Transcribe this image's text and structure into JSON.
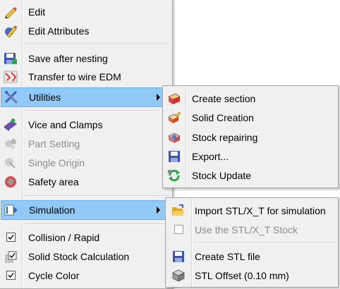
{
  "main_menu": {
    "items": [
      {
        "id": "edit",
        "label": "Edit",
        "icon": "pencil-icon",
        "enabled": true
      },
      {
        "id": "edit-attributes",
        "label": "Edit Attributes",
        "icon": "edit-attributes-icon",
        "enabled": true
      },
      {
        "id": "save-after-nesting",
        "label": "Save after nesting",
        "icon": "save-after-nesting-icon",
        "enabled": true
      },
      {
        "id": "transfer-to-wire-edm",
        "label": "Transfer to wire EDM",
        "icon": "wire-edm-icon",
        "enabled": true
      },
      {
        "id": "utilities",
        "label": "Utilities",
        "icon": "utilities-icon",
        "enabled": true,
        "submenu": true,
        "highlighted": true
      },
      {
        "id": "vice-and-clamps",
        "label": "Vice and Clamps",
        "icon": "vice-icon",
        "enabled": true
      },
      {
        "id": "part-setting",
        "label": "Part Setting",
        "icon": "part-setting-icon",
        "enabled": false
      },
      {
        "id": "single-origin",
        "label": "Single Origin",
        "icon": "origin-icon",
        "enabled": false
      },
      {
        "id": "safety-area",
        "label": "Safety area",
        "icon": "safety-area-icon",
        "enabled": true
      },
      {
        "id": "simulation",
        "label": "Simulation",
        "icon": "simulation-icon",
        "enabled": true,
        "submenu": true,
        "highlighted": true
      },
      {
        "id": "collision-rapid",
        "label": "Collision / Rapid",
        "checked": true,
        "enabled": true
      },
      {
        "id": "solid-stock-calculation",
        "label": "Solid Stock Calculation",
        "checked": true,
        "enabled": true
      },
      {
        "id": "cycle-color",
        "label": "Cycle Color",
        "checked": true,
        "enabled": true
      }
    ]
  },
  "utilities_submenu": {
    "items": [
      {
        "id": "create-section",
        "label": "Create section",
        "icon": "section-icon"
      },
      {
        "id": "solid-creation",
        "label": "Solid Creation",
        "icon": "solid-creation-icon"
      },
      {
        "id": "stock-repairing",
        "label": "Stock repairing",
        "icon": "stock-repair-icon"
      },
      {
        "id": "export",
        "label": "Export...",
        "icon": "floppy-icon"
      },
      {
        "id": "stock-update",
        "label": "Stock Update",
        "icon": "refresh-icon"
      }
    ]
  },
  "simulation_submenu": {
    "items": [
      {
        "id": "import-stl",
        "label": "Import STL/X_T for simulation",
        "icon": "folder-open-icon",
        "enabled": true
      },
      {
        "id": "use-stl-stock",
        "label": "Use the STL/X_T Stock",
        "checked": false,
        "enabled": false
      },
      {
        "id": "create-stl-file",
        "label": "Create STL file",
        "icon": "floppy-icon",
        "enabled": true
      },
      {
        "id": "stl-offset",
        "label": "STL Offset (0.10 mm)",
        "icon": "cube-icon",
        "enabled": true
      }
    ]
  },
  "colors": {
    "menu_bg": "#f0f0f0",
    "highlight_bg": "#91c9f7",
    "highlight_border": "#6fb1ec",
    "disabled_text": "#8c8c8c"
  }
}
